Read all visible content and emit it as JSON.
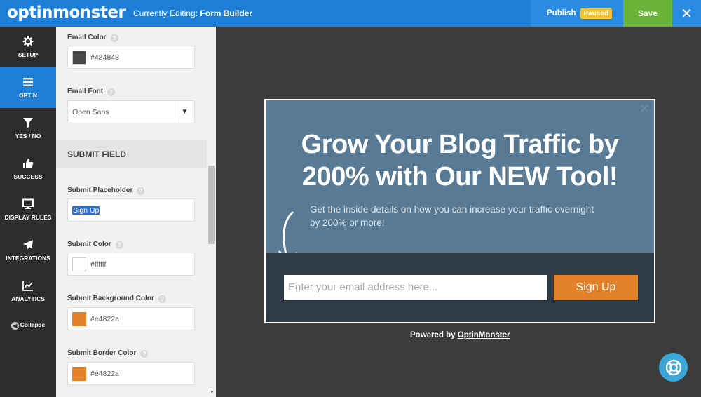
{
  "topbar": {
    "logo_text": "optinmonster",
    "editing_prefix": "Currently Editing:",
    "editing_name": "Form Builder",
    "publish_label": "Publish",
    "status_badge": "Paused",
    "save_label": "Save",
    "close_symbol": "✕"
  },
  "nav": {
    "items": [
      {
        "label": "SETUP",
        "icon": "gear-icon",
        "active": false
      },
      {
        "label": "OPTIN",
        "icon": "menu-icon",
        "active": true
      },
      {
        "label": "YES / NO",
        "icon": "filter-icon",
        "active": false
      },
      {
        "label": "SUCCESS",
        "icon": "thumbs-up-icon",
        "active": false
      },
      {
        "label": "DISPLAY RULES",
        "icon": "monitor-icon",
        "active": false
      },
      {
        "label": "INTEGRATIONS",
        "icon": "paper-plane-icon",
        "active": false
      },
      {
        "label": "ANALYTICS",
        "icon": "line-chart-icon",
        "active": false
      }
    ],
    "collapse_label": "Collapse"
  },
  "panel": {
    "email_color_label": "Email Color",
    "email_color_value": "#484848",
    "email_font_label": "Email Font",
    "email_font_value": "Open Sans",
    "submit_section_title": "SUBMIT FIELD",
    "submit_placeholder_label": "Submit Placeholder",
    "submit_placeholder_value": "Sign Up",
    "submit_color_label": "Submit Color",
    "submit_color_value": "#ffffff",
    "submit_bg_label": "Submit Background Color",
    "submit_bg_value": "#e4822a",
    "submit_border_label": "Submit Border Color",
    "submit_border_value": "#e4822a",
    "help_symbol": "?"
  },
  "popup": {
    "headline": "Grow Your Blog Traffic by 200% with Our NEW Tool!",
    "subtext": "Get the inside details on how you can increase your traffic overnight by 200% or more!",
    "email_placeholder": "Enter your email address here...",
    "submit_label": "Sign Up",
    "close_symbol": "✕",
    "background_color": "#587a94",
    "bottom_color": "#2f3c48"
  },
  "powered": {
    "prefix": "Powered by",
    "brand": "OptinMonster"
  },
  "colors": {
    "brand_blue": "#1d7ed8",
    "save_green": "#6ab339",
    "paused_yellow": "#f2c230",
    "accent_orange": "#e4822a"
  }
}
